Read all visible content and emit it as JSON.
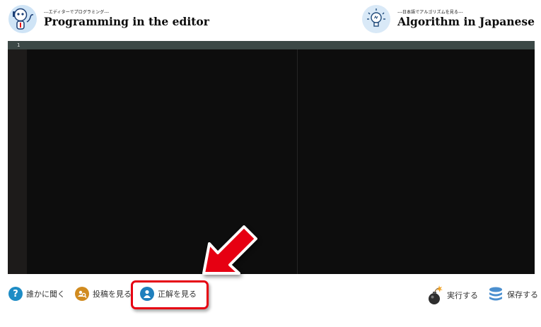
{
  "header": {
    "left_subtitle": "---エディターでプログラミング---",
    "left_title": "Programming in the editor",
    "right_subtitle": "---日本語でアルゴリズムを見る---",
    "right_title": "Algorithm in Japanese"
  },
  "editor": {
    "line_numbers": [
      "1"
    ]
  },
  "toolbar": {
    "ask_label": "誰かに聞く",
    "posts_label": "投稿を見る",
    "answer_label": "正解を見る",
    "run_label": "実行する",
    "save_label": "保存する"
  },
  "icons": {
    "logo": "robot-mascot-icon",
    "algorithm": "lightbulb-icon",
    "ask": "question-icon",
    "posts": "search-people-icon",
    "answer": "person-icon",
    "run": "bomb-icon",
    "save": "database-icon"
  },
  "colors": {
    "highlight": "#e60012",
    "editor_bg": "#0d0d0d",
    "ask_icon": "#1e8cc5",
    "posts_icon": "#d18b1f",
    "answer_icon": "#1f7fbd",
    "save_icon": "#4b8fcf"
  }
}
